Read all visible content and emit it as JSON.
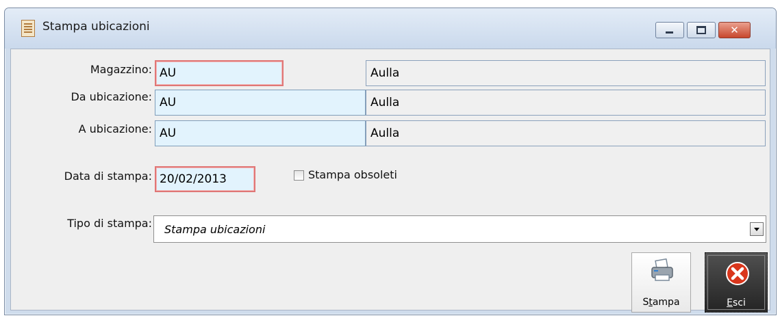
{
  "window": {
    "title": "Stampa ubicazioni",
    "close_glyph": "✕"
  },
  "fields": {
    "magazzino": {
      "label": "Magazzino:",
      "code": "AU",
      "desc": "Aulla"
    },
    "da_ubicazione": {
      "label": "Da ubicazione:",
      "code": "AU",
      "desc": "Aulla"
    },
    "a_ubicazione": {
      "label": "A ubicazione:",
      "code": "AU",
      "desc": "Aulla"
    },
    "data_stampa": {
      "label": "Data di stampa:",
      "value": "20/02/2013"
    }
  },
  "stampa_obsoleti": {
    "label": "Stampa obsoleti",
    "checked": false
  },
  "tipo_stampa": {
    "label": "Tipo di stampa:",
    "value": "Stampa ubicazioni"
  },
  "buttons": {
    "stampa": {
      "label_pre": "S",
      "label_ul": "t",
      "label_post": "ampa",
      "icon": "printer-icon"
    },
    "esci": {
      "label_ul": "E",
      "label_post": "sci",
      "icon": "stop-icon"
    }
  },
  "colors": {
    "code_field_bg": "#e2f3fd",
    "focus_border": "#e07676",
    "esci_bg": "#2b2b2b"
  }
}
